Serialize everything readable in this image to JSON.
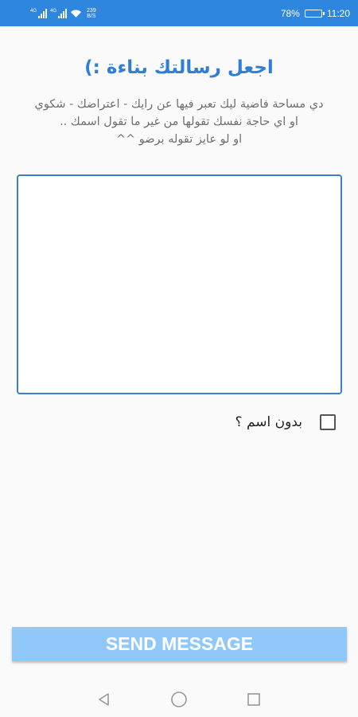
{
  "status_bar": {
    "signal1_label": "4G",
    "signal2_label": "4G",
    "net_speed_value": "239",
    "net_speed_unit": "B/S",
    "battery_percent": "78%",
    "battery_level": 0.78,
    "time": "11:20"
  },
  "page": {
    "title": "اجعل رسالتك بناءة :)",
    "description_lines": [
      "دي مساحة فاضية ليك تعبر فيها عن رايك - اعتراضك - شكوي",
      "او اي حاجة نفسك تقولها من غير ما تقول اسمك ..",
      "او لو عايز تقوله برضو ^^"
    ]
  },
  "message_box": {
    "value": "",
    "placeholder": ""
  },
  "anonymous": {
    "label": "بدون اسم ؟",
    "checked": false
  },
  "send_button": {
    "label": "SEND MESSAGE"
  },
  "nav": {
    "back": "back-icon",
    "home": "home-icon",
    "recents": "recents-icon"
  },
  "colors": {
    "status_bar": "#2e86de",
    "title": "#2f7fd8",
    "send_button_bg": "#90c9f9",
    "textarea_border": "#3b7fc8"
  }
}
